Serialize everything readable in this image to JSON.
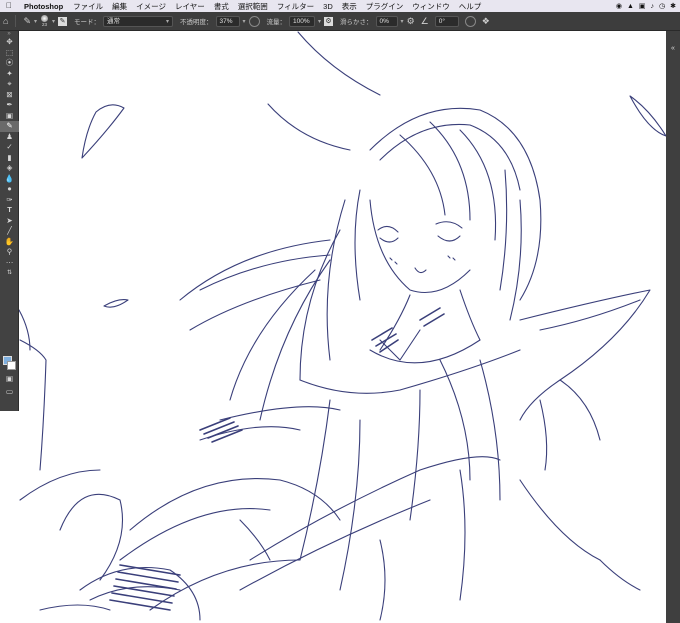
{
  "menubar": {
    "apple_icon": "apple-icon",
    "app_name": "Photoshop",
    "items": [
      "ファイル",
      "編集",
      "イメージ",
      "レイヤー",
      "書式",
      "選択範囲",
      "フィルター",
      "3D",
      "表示",
      "プラグイン",
      "ウィンドウ",
      "ヘルプ"
    ]
  },
  "options": {
    "brush_size": "23",
    "mode_label": "モード：",
    "mode_value": "通常",
    "opacity_label": "不透明度：",
    "opacity_value": "37%",
    "flow_label": "流量：",
    "flow_value": "100%",
    "smoothing_label": "滑らかさ：",
    "smoothing_value": "0%",
    "angle_value": "0°"
  },
  "colors": {
    "foreground": "#7fb0df",
    "background": "#ffffff",
    "ink": "#3a3f7a"
  }
}
